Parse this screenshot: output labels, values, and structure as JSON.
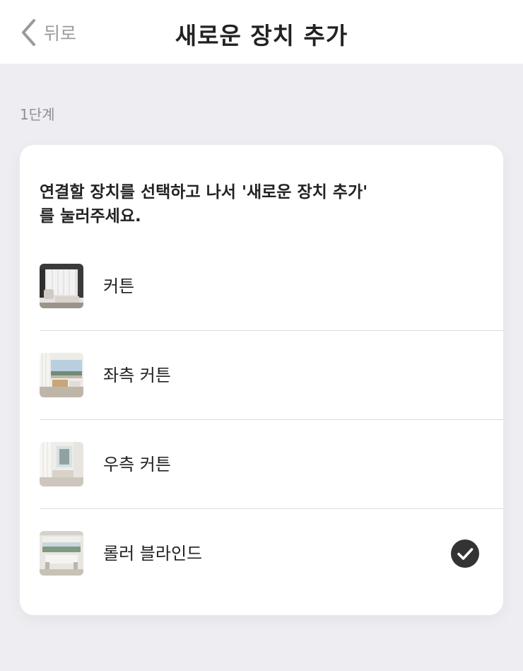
{
  "header": {
    "back_label": "뒤로",
    "title": "새로운 장치 추가"
  },
  "step": {
    "label": "1단계"
  },
  "instruction": "연결할 장치를 선택하고 나서 '새로운 장치 추가'\n를 눌러주세요.",
  "devices": [
    {
      "label": "커튼",
      "icon": "curtain-room-photo",
      "selected": false
    },
    {
      "label": "좌측 커튼",
      "icon": "left-curtain-room-photo",
      "selected": false
    },
    {
      "label": "우측 커튼",
      "icon": "right-curtain-room-photo",
      "selected": false
    },
    {
      "label": "롤러 블라인드",
      "icon": "roller-blind-room-photo",
      "selected": true
    }
  ],
  "colors": {
    "background": "#eeeef2",
    "card": "#ffffff",
    "check": "#333333",
    "muted_text": "#8e8e93"
  }
}
